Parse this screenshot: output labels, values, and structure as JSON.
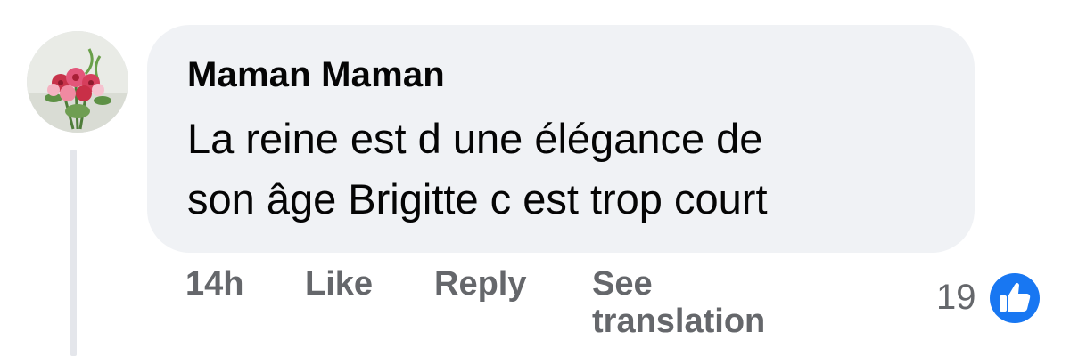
{
  "comment": {
    "author": "Maman Maman",
    "text": "La reine est d une élégance de\nson âge Brigitte c est trop court"
  },
  "actions": {
    "time": "14h",
    "like_label": "Like",
    "reply_label": "Reply",
    "translate_label": "See\ntranslation"
  },
  "reactions": {
    "count": "19",
    "icon": "thumbs-up-icon",
    "badge_color": "#1877f2"
  },
  "avatar": {
    "icon": "flower-bouquet-avatar"
  }
}
